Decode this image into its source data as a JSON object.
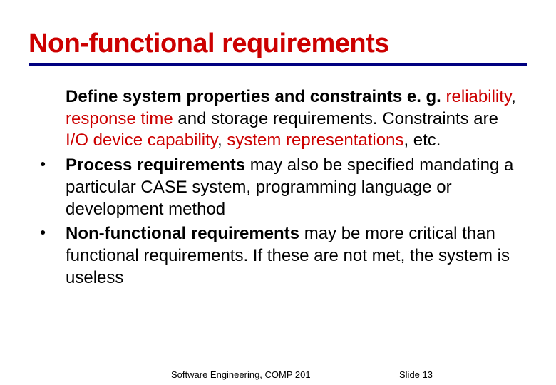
{
  "title": "Non-functional requirements",
  "items": [
    {
      "bullet": false,
      "segments": [
        {
          "t": "Define system properties",
          "b": true,
          "r": false
        },
        {
          "t": " and ",
          "b": true,
          "r": false
        },
        {
          "t": "constraints",
          "b": true,
          "r": false
        },
        {
          "t": " e. g. ",
          "b": true,
          "r": false
        },
        {
          "t": "reliability",
          "b": false,
          "r": true
        },
        {
          "t": ", ",
          "b": false,
          "r": false
        },
        {
          "t": "response time",
          "b": false,
          "r": true
        },
        {
          "t": " and storage requirements. Constraints are ",
          "b": false,
          "r": false
        },
        {
          "t": "I/O device capability",
          "b": false,
          "r": true
        },
        {
          "t": ", ",
          "b": false,
          "r": false
        },
        {
          "t": "system representations",
          "b": false,
          "r": true
        },
        {
          "t": ", etc.",
          "b": false,
          "r": false
        }
      ]
    },
    {
      "bullet": true,
      "segments": [
        {
          "t": "Process requirements",
          "b": true,
          "r": false
        },
        {
          "t": " may also be specified mandating a particular CASE system, programming language or development method",
          "b": false,
          "r": false
        }
      ]
    },
    {
      "bullet": true,
      "segments": [
        {
          "t": "Non-functional requirements",
          "b": true,
          "r": false
        },
        {
          "t": " may be more critical than functional requirements. If these are not met, the system is useless",
          "b": false,
          "r": false
        }
      ]
    }
  ],
  "footer": {
    "left": "Software Engineering, COMP 201",
    "right_label": "Slide",
    "right_number": "13"
  }
}
